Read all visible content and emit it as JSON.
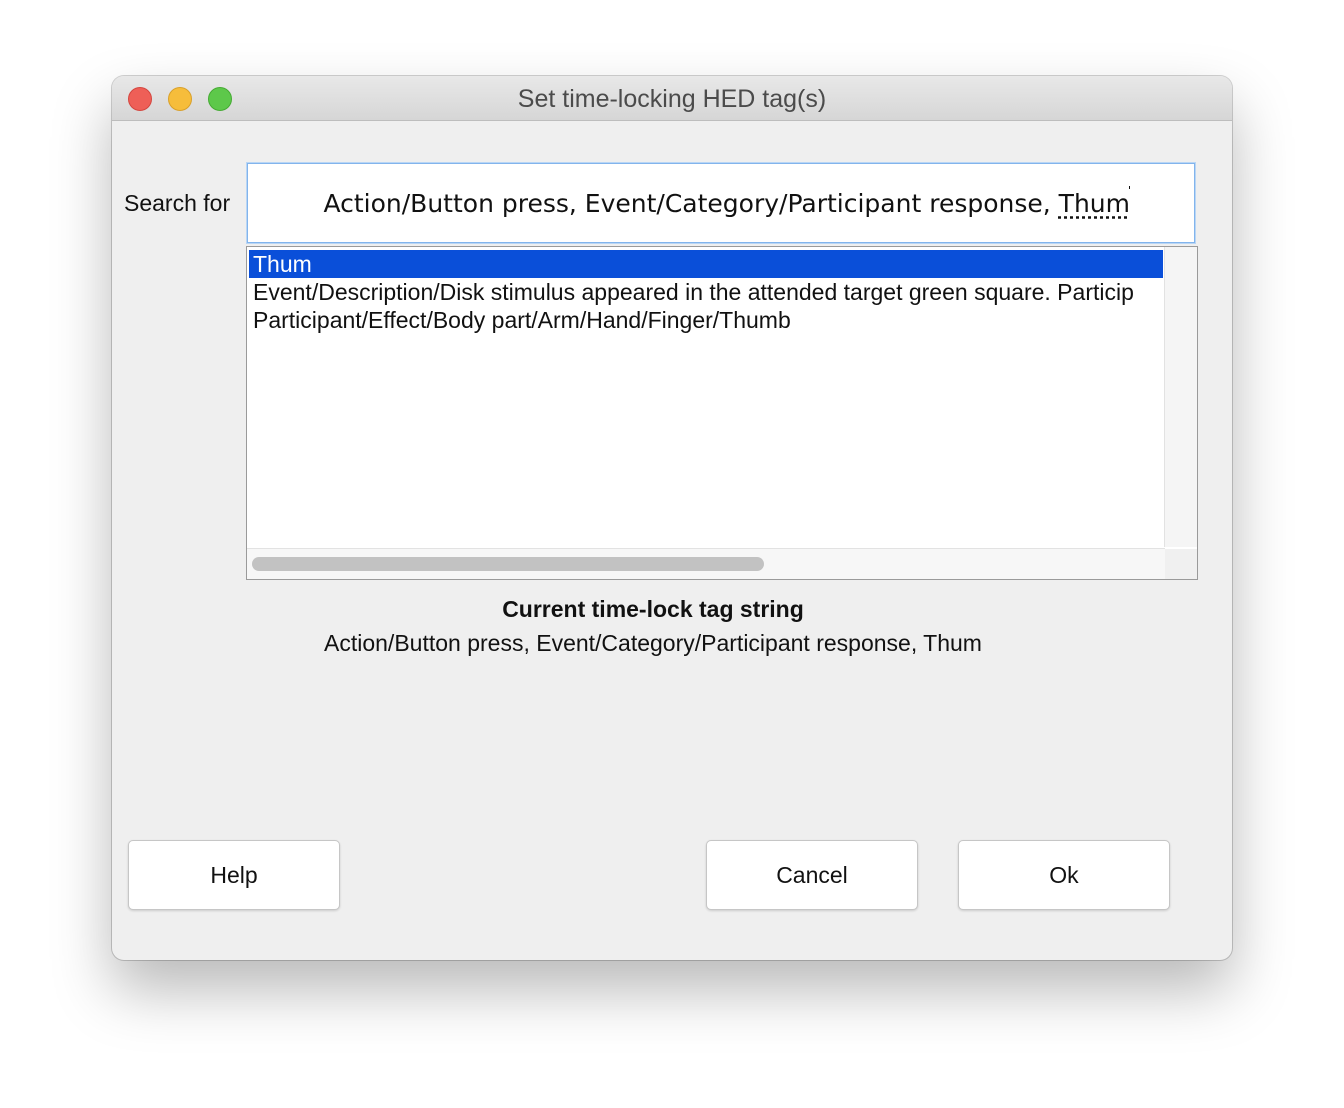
{
  "window": {
    "title": "Set time-locking HED tag(s)"
  },
  "search": {
    "label": "Search for",
    "value_prefix": "Action/Button press, Event/Category/Participant response, ",
    "value_current_token": "Thum"
  },
  "suggestions": {
    "items": [
      {
        "label": "Thum",
        "selected": true
      },
      {
        "label": "Event/Description/Disk stimulus appeared in the attended target green square. Particip",
        "selected": false
      },
      {
        "label": "Participant/Effect/Body part/Arm/Hand/Finger/Thumb",
        "selected": false
      }
    ]
  },
  "current": {
    "title": "Current time-lock tag string",
    "value": "Action/Button press, Event/Category/Participant response, Thum"
  },
  "buttons": {
    "help": "Help",
    "cancel": "Cancel",
    "ok": "Ok"
  },
  "colors": {
    "selection": "#0a4fd9",
    "window_bg": "#efefef",
    "close": "#ee5f57",
    "minimize": "#f6bd3b",
    "maximize": "#5dc84a"
  }
}
